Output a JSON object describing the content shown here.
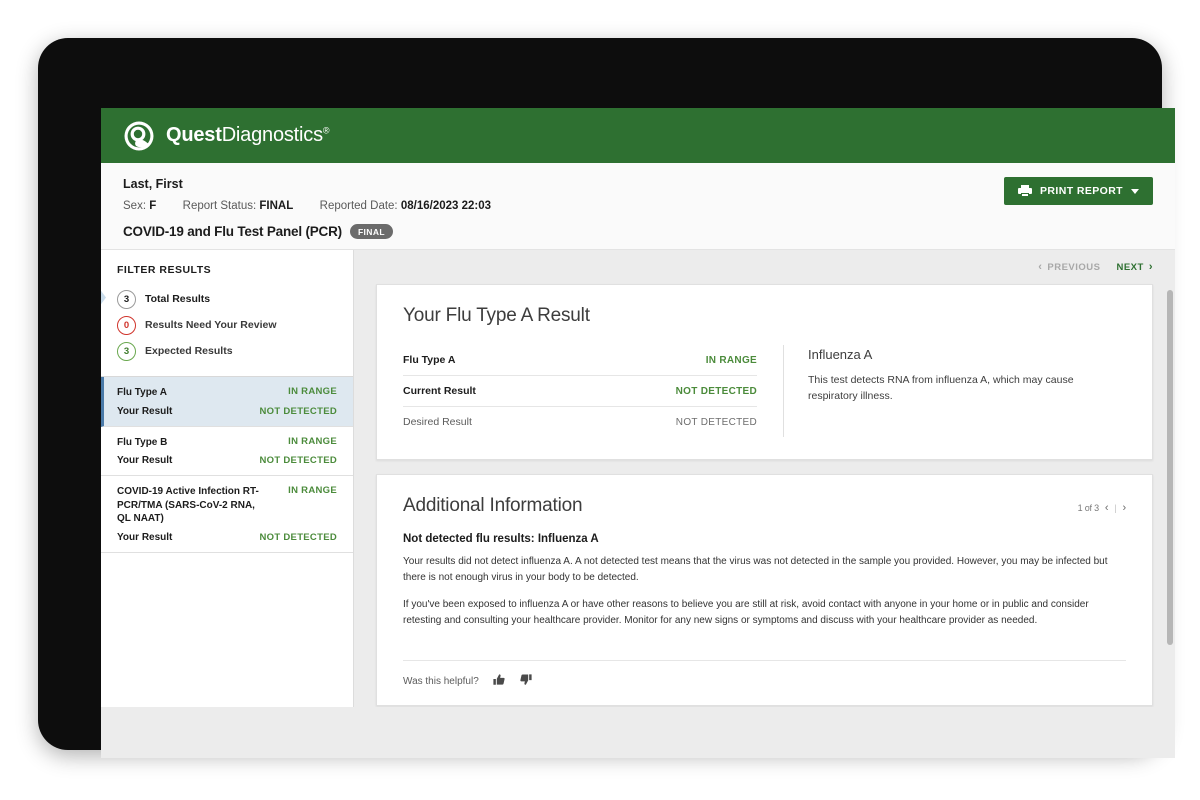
{
  "brand": {
    "name_bold": "Quest",
    "name_light": "Diagnostics",
    "trademark": "®",
    "logo_icon": "quest-swirl-logo-icon",
    "color": "#2e7031"
  },
  "patient": {
    "name": "Last, First",
    "sex_label": "Sex:",
    "sex_value": "F",
    "report_status_label": "Report Status:",
    "report_status_value": "FINAL",
    "reported_date_label": "Reported Date:",
    "reported_date_value": "08/16/2023 22:03",
    "panel_title": "COVID-19 and Flu Test Panel (PCR)",
    "panel_status_chip": "FINAL"
  },
  "toolbar": {
    "print_label": "PRINT REPORT",
    "print_icon": "printer-icon",
    "caret_icon": "chevron-down-icon"
  },
  "sidebar": {
    "filter_title": "FILTER RESULTS",
    "filters": [
      {
        "count": "3",
        "label": "Total Results",
        "badge_color": "#9a9a9a",
        "active": true
      },
      {
        "count": "0",
        "label": "Results Need Your Review",
        "badge_color": "#d0342c",
        "active": false
      },
      {
        "count": "3",
        "label": "Expected Results",
        "badge_color": "#6aa84f",
        "active": false
      }
    ],
    "results": [
      {
        "name": "Flu Type A",
        "status": "IN RANGE",
        "your_result_label": "Your Result",
        "your_result_value": "NOT DETECTED",
        "selected": true
      },
      {
        "name": "Flu Type B",
        "status": "IN RANGE",
        "your_result_label": "Your Result",
        "your_result_value": "NOT DETECTED",
        "selected": false
      },
      {
        "name": "COVID-19 Active Infection RT-PCR/TMA (SARS-CoV-2 RNA, QL NAAT)",
        "status": "IN RANGE",
        "your_result_label": "Your Result",
        "your_result_value": "NOT DETECTED",
        "selected": false
      }
    ]
  },
  "main": {
    "nav": {
      "previous_label": "PREVIOUS",
      "next_label": "NEXT",
      "previous_enabled": false,
      "next_enabled": true
    },
    "result_card": {
      "title": "Your Flu Type A Result",
      "table": {
        "analyte_name": "Flu Type A",
        "analyte_status": "IN RANGE",
        "current_result_label": "Current Result",
        "current_result_value": "NOT DETECTED",
        "desired_result_label": "Desired Result",
        "desired_result_value": "NOT DETECTED"
      },
      "description": {
        "title": "Influenza A",
        "text": "This test detects RNA from influenza A, which may cause respiratory illness."
      }
    },
    "additional_info": {
      "title": "Additional Information",
      "pager_text": "1 of 3",
      "pager_prev_icon": "chevron-left-icon",
      "pager_next_icon": "chevron-right-icon",
      "subtitle": "Not detected flu results: Influenza A",
      "paragraph_1": "Your results did not detect influenza A. A not detected test means that the virus was not detected in the sample you provided. However, you may be infected but there is not enough virus in your body to be detected.",
      "paragraph_2": "If you've been exposed to influenza A or have other reasons to believe you are still at risk, avoid contact with anyone in your home or in public and consider retesting and consulting your healthcare provider. Monitor for any new signs or symptoms and discuss with your healthcare provider as needed.",
      "helpful_label": "Was this helpful?",
      "thumb_up_icon": "thumbs-up-icon",
      "thumb_down_icon": "thumbs-down-icon",
      "thumb_up_glyph": "👍",
      "thumb_down_glyph": "👍"
    }
  }
}
